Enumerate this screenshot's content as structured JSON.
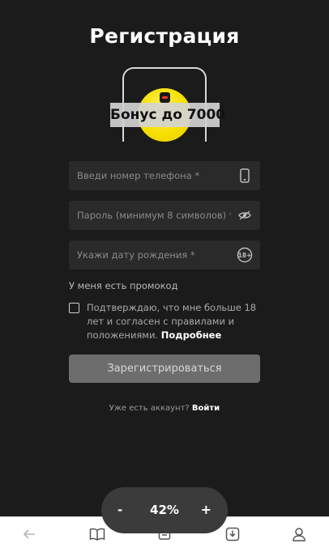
{
  "page": {
    "title": "Регистрация"
  },
  "promo": {
    "banner": "Бонус до 7000"
  },
  "form": {
    "phone_placeholder": "Введи номер телефона *",
    "password_placeholder": "Пароль (минимум 8 символов) *",
    "birthdate_placeholder": "Укажи дату рождения *",
    "age_badge": "18+",
    "promo_code_link": "У меня есть промокод",
    "consent_text": "Подтверждаю, что мне больше 18 лет и согласен с правилами и положениями.",
    "consent_more_link": "Подробнее",
    "submit_label": "Зарегистрироваться",
    "have_account_text": "Уже есть аккаунт?",
    "login_link": "Войти"
  },
  "zoom": {
    "minus": "-",
    "value": "42%",
    "plus": "+"
  },
  "bottom_nav": {
    "icons": [
      "back-arrow-icon",
      "book-icon",
      "tray-icon",
      "download-icon",
      "profile-icon"
    ]
  },
  "colors": {
    "background": "#1b1b1b",
    "field": "#2a2a2a",
    "button": "#6d6d6d",
    "accent_yellow": "#f6e000"
  }
}
